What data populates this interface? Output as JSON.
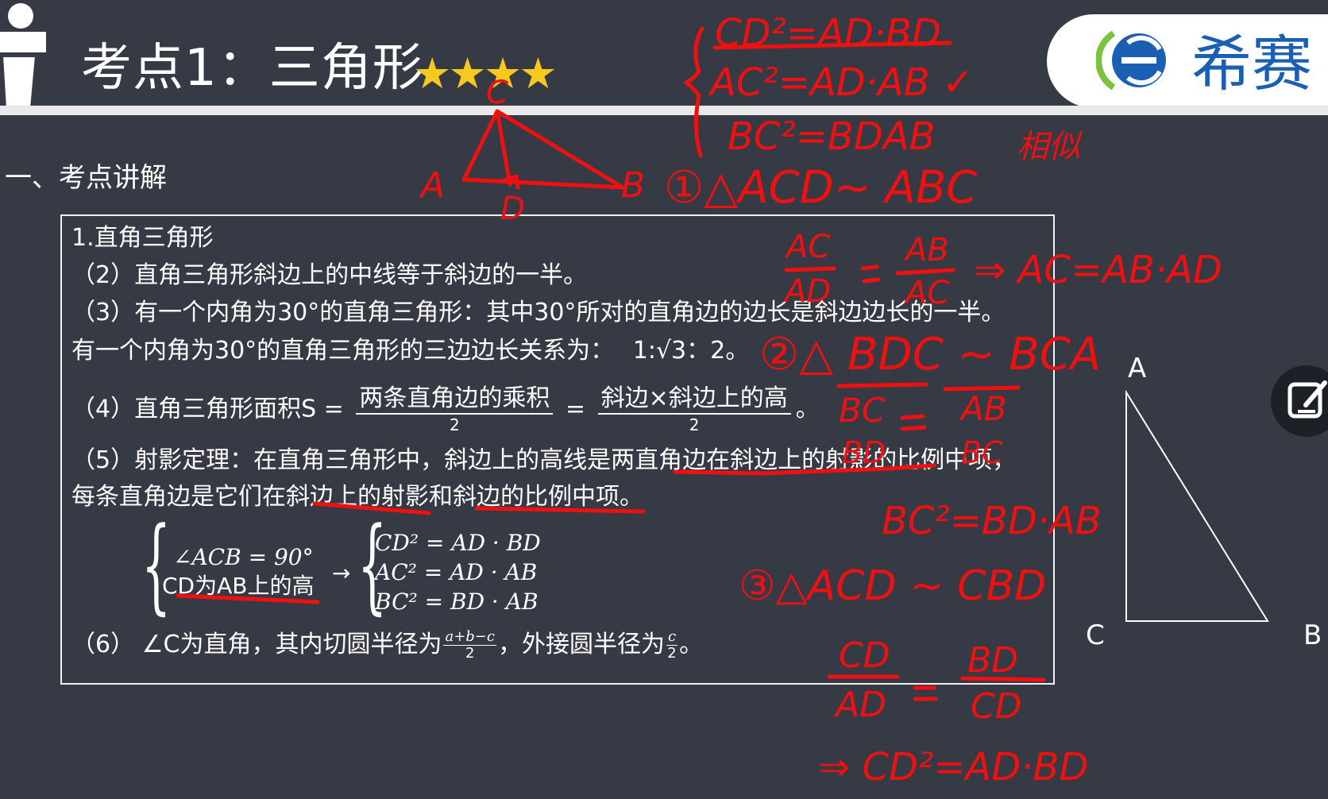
{
  "header": {
    "title": "考点1：三角形",
    "stars": "★★★★",
    "logo_text": "希赛"
  },
  "section_heading": "一、考点讲解",
  "content": {
    "heading": "1.直角三角形",
    "item2": "（2）直角三角形斜边上的中线等于斜边的一半。",
    "item3_a": "（3）有一个内角为30°的直角三角形：其中30°所对的直角边的边长是斜边边长的一半。",
    "item3_b": "有一个内角为30°的直角三角形的三边边长关系为：",
    "item3_ratio_1": "1:",
    "item3_ratio_sqrt": "√3",
    "item3_ratio_2": "：2。",
    "item4_prefix": "（4）直角三角形面积S =",
    "item4_frac1_num": "两条直角边的乘积",
    "item4_frac1_den": "2",
    "item4_eq": "=",
    "item4_frac2_num": "斜边×斜边上的高",
    "item4_frac2_den": "2",
    "item4_end": "。",
    "item5_a": "（5）射影定理：在直角三角形中，斜边上的高线是两直角边在斜边上的射影的比例中项，",
    "item5_b": "每条直角边是它们在斜边上的射影和斜边的比例中项。",
    "cond1": "∠ACB = 90°",
    "cond2": "CD为AB上的高",
    "arrow": "→",
    "res1": "CD² = AD · BD",
    "res2": "AC² = AD · AB",
    "res3": "BC² = BD · AB",
    "item6_prefix": "（6） ∠C为直角，其内切圆半径为",
    "item6_frac1_num": "a+b−c",
    "item6_frac1_den": "2",
    "item6_mid": "，外接圆半径为",
    "item6_frac2_num": "c",
    "item6_frac2_den": "2",
    "item6_end": "。"
  },
  "triangle_labels": {
    "a": "A",
    "b": "B",
    "c": "C"
  },
  "ink_notes": {
    "top1": "CD²=AD·BD",
    "top2": "AC²=AD·AB ✓",
    "top3": "BC²=BDAB",
    "similar": "相似",
    "sketch_a": "A",
    "sketch_b": "B",
    "sketch_c": "C",
    "sketch_d": "D",
    "sim1": "①△ACD∼ ABC",
    "ratio1_num1": "AC",
    "ratio1_den1": "AD",
    "ratio1_num2": "AB",
    "ratio1_den2": "AC",
    "ratio1_result": "⇒ AC=AB·AD",
    "sim2": "②△ BDC ∼ BCA",
    "ratio2_num1": "BC",
    "ratio2_den1": "BD",
    "ratio2_num2": "AB",
    "ratio2_den2": "BC",
    "ratio2_result": "BC²=BD·AB",
    "sim3": "③△ACD ∼ CBD",
    "ratio3_num1": "CD",
    "ratio3_den1": "AD",
    "ratio3_num2": "BD",
    "ratio3_den2": "CD",
    "ratio3_result": "⇒ CD²=AD·BD"
  },
  "colors": {
    "background": "#363a45",
    "ink": "#f01010",
    "star": "#f7c81e",
    "logo_blue": "#1a5fb4",
    "logo_green": "#7cc242"
  },
  "icons": [
    "presenter-icon",
    "logo-icon",
    "edit-icon"
  ]
}
